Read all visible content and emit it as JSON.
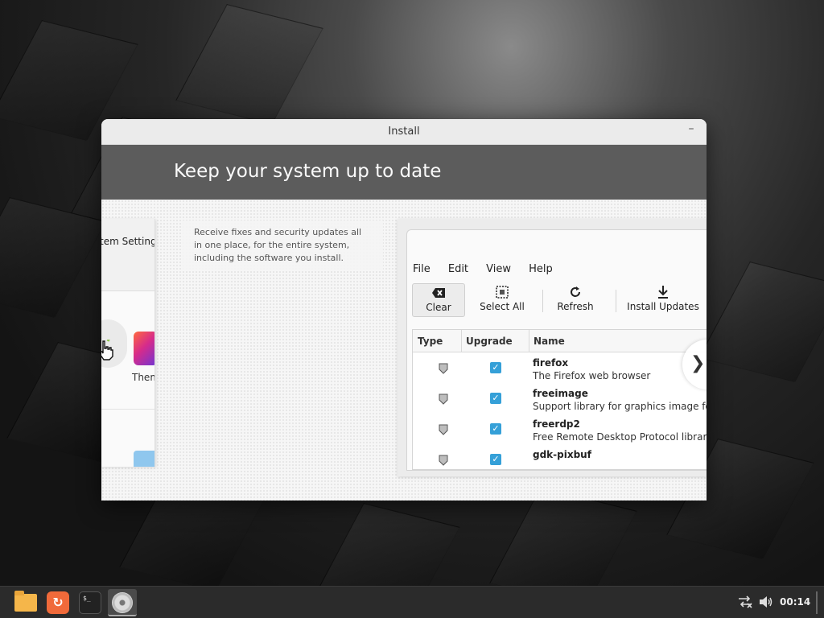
{
  "window": {
    "title": "Install",
    "minimize_glyph": "–",
    "heading": "Keep your system up to date"
  },
  "left_preview": {
    "header_text": "tem Setting",
    "themes_label": "Them"
  },
  "description": "Receive fixes and security updates all in one place, for the entire system, including the software you install.",
  "update_manager": {
    "menu": [
      "File",
      "Edit",
      "View",
      "Help"
    ],
    "toolbar": {
      "clear": "Clear",
      "select_all": "Select All",
      "refresh": "Refresh",
      "install_updates": "Install Updates"
    },
    "columns": [
      "Type",
      "Upgrade",
      "Name"
    ],
    "rows": [
      {
        "name": "firefox",
        "desc": "The Firefox web browser",
        "checked": true
      },
      {
        "name": "freeimage",
        "desc": "Support library for graphics image fo",
        "checked": true
      },
      {
        "name": "freerdp2",
        "desc": "Free Remote Desktop Protocol librar",
        "checked": true
      },
      {
        "name": "gdk-pixbuf",
        "desc": "",
        "checked": true
      }
    ]
  },
  "next_glyph": "❯",
  "taskbar": {
    "apps": [
      {
        "name": "files",
        "icon": "folder-icon"
      },
      {
        "name": "software",
        "icon": "software-icon"
      },
      {
        "name": "terminal",
        "icon": "terminal-icon",
        "prompt": "$_"
      },
      {
        "name": "installer",
        "icon": "disc-icon",
        "active": true
      }
    ],
    "clock": "00:14"
  },
  "colors": {
    "accent": "#35a0d8",
    "banner": "#5c5c5c",
    "taskbar": "#2b2b2b"
  }
}
